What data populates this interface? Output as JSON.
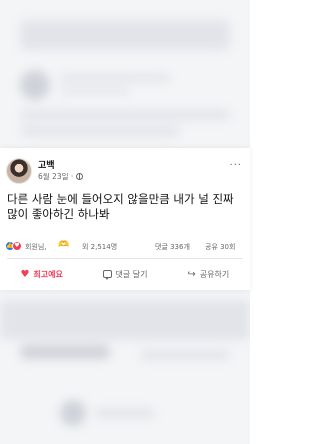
{
  "post": {
    "author": "고백",
    "date": "6월 23일 ·",
    "more": "···",
    "text": "다른 사람 눈에 들어오지 않을만큼 내가 널 진짜 많이 좋아하긴 하나봐"
  },
  "stats": {
    "reactions_icons": [
      "like-icon",
      "love-icon"
    ],
    "names": "회원님,",
    "heart_emoji": "🫶",
    "views": "외 2,514명",
    "comments": "댓글 336개",
    "shares": "공유 30회"
  },
  "actions": [
    {
      "label": "최고예요",
      "icon": "heart-icon",
      "active": true
    },
    {
      "label": "댓글 달기",
      "icon": "comment-icon",
      "active": false
    },
    {
      "label": "공유하기",
      "icon": "share-icon",
      "active": false
    }
  ],
  "colors": {
    "accent_love": "#f33e58",
    "accent_like": "#1877f2",
    "text_muted": "#65676b"
  }
}
